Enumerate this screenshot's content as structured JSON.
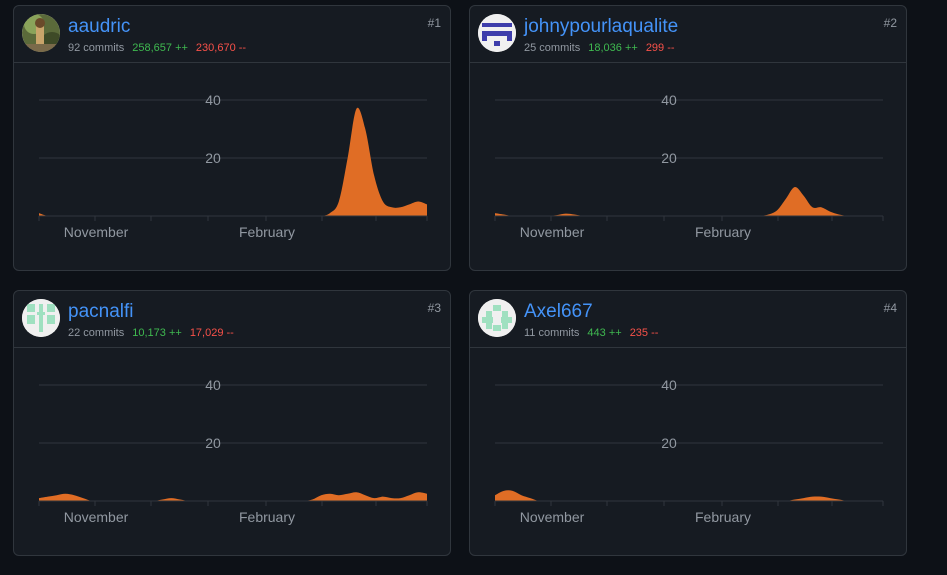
{
  "colors": {
    "background": "#0d1117",
    "card": "#161b22",
    "border": "#30363d",
    "username": "#4493f8",
    "additions": "#3fb950",
    "deletions": "#f85149",
    "area": "#e06d25",
    "grid": "#30363d"
  },
  "contributors": [
    {
      "username": "aaudric",
      "commits": "92 commits",
      "additions": "258,657 ++",
      "deletions": "230,670 --",
      "rank": "#1",
      "avatar_icon": "photo-avatar-icon"
    },
    {
      "username": "johnypourlaqualite",
      "commits": "25 commits",
      "additions": "18,036 ++",
      "deletions": "299 --",
      "rank": "#2",
      "avatar_icon": "identicon-blue-icon"
    },
    {
      "username": "pacnalfi",
      "commits": "22 commits",
      "additions": "10,173 ++",
      "deletions": "17,029 --",
      "rank": "#3",
      "avatar_icon": "identicon-green-icon"
    },
    {
      "username": "Axel667",
      "commits": "11 commits",
      "additions": "443 ++",
      "deletions": "235 --",
      "rank": "#4",
      "avatar_icon": "identicon-green-cross-icon"
    }
  ],
  "chart_data": [
    {
      "type": "area",
      "series": [
        {
          "values": [
            1,
            0,
            0,
            0,
            0,
            0,
            0,
            0,
            0,
            0,
            0,
            0,
            0,
            0,
            0,
            0,
            0,
            0,
            0,
            0,
            0,
            0,
            0,
            0,
            0,
            0,
            0,
            0,
            0,
            0,
            0,
            0,
            0,
            1,
            5,
            20,
            37,
            30,
            14,
            5,
            3,
            3,
            4,
            5,
            4
          ]
        }
      ],
      "x_tick_labels": [
        "November",
        "February"
      ],
      "y_ticks": [
        20,
        40
      ],
      "ylim": [
        0,
        50
      ],
      "grid": true
    },
    {
      "type": "area",
      "series": [
        {
          "values": [
            1,
            0.5,
            0,
            0,
            0,
            0,
            0,
            0.3,
            0.8,
            0.5,
            0,
            0,
            0,
            0,
            0,
            0,
            0,
            0,
            0,
            0,
            0,
            0,
            0,
            0,
            0,
            0,
            0,
            0,
            0,
            0,
            0,
            0.5,
            2,
            6,
            10,
            7,
            3,
            3,
            1.5,
            0.5,
            0,
            0,
            0,
            0,
            0
          ]
        }
      ],
      "x_tick_labels": [
        "November",
        "February"
      ],
      "y_ticks": [
        20,
        40
      ],
      "ylim": [
        0,
        50
      ],
      "grid": true
    },
    {
      "type": "area",
      "series": [
        {
          "values": [
            1,
            1.5,
            2,
            2.5,
            2,
            1,
            0,
            0,
            0,
            0,
            0,
            0,
            0,
            0,
            0.5,
            1,
            0.5,
            0,
            0,
            0,
            0,
            0,
            0,
            0,
            0,
            0,
            0,
            0,
            0,
            0,
            0,
            0.5,
            2,
            2.5,
            2,
            2.5,
            3,
            2,
            1,
            1.5,
            1,
            1,
            2,
            3,
            2.5
          ]
        }
      ],
      "x_tick_labels": [
        "November",
        "February"
      ],
      "y_ticks": [
        20,
        40
      ],
      "ylim": [
        0,
        50
      ],
      "grid": true
    },
    {
      "type": "area",
      "series": [
        {
          "values": [
            2,
            3.5,
            3.5,
            2,
            1,
            0,
            0,
            0,
            0,
            0,
            0,
            0,
            0,
            0,
            0,
            0,
            0,
            0,
            0,
            0,
            0,
            0,
            0,
            0,
            0,
            0,
            0,
            0,
            0,
            0,
            0,
            0,
            0,
            0,
            0.5,
            1,
            1.5,
            1.5,
            1,
            0.5,
            0,
            0,
            0,
            0,
            0
          ]
        }
      ],
      "x_tick_labels": [
        "November",
        "February"
      ],
      "y_ticks": [
        20,
        40
      ],
      "ylim": [
        0,
        50
      ],
      "grid": true
    }
  ]
}
